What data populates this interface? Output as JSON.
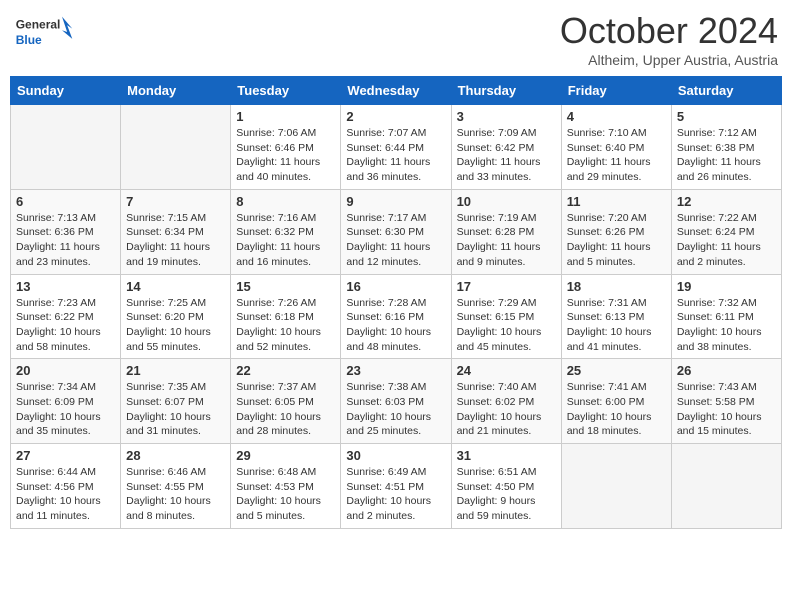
{
  "header": {
    "logo_general": "General",
    "logo_blue": "Blue",
    "month_title": "October 2024",
    "location": "Altheim, Upper Austria, Austria"
  },
  "days_of_week": [
    "Sunday",
    "Monday",
    "Tuesday",
    "Wednesday",
    "Thursday",
    "Friday",
    "Saturday"
  ],
  "weeks": [
    [
      {
        "day": "",
        "sunrise": "",
        "sunset": "",
        "daylight": ""
      },
      {
        "day": "",
        "sunrise": "",
        "sunset": "",
        "daylight": ""
      },
      {
        "day": "1",
        "sunrise": "Sunrise: 7:06 AM",
        "sunset": "Sunset: 6:46 PM",
        "daylight": "Daylight: 11 hours and 40 minutes."
      },
      {
        "day": "2",
        "sunrise": "Sunrise: 7:07 AM",
        "sunset": "Sunset: 6:44 PM",
        "daylight": "Daylight: 11 hours and 36 minutes."
      },
      {
        "day": "3",
        "sunrise": "Sunrise: 7:09 AM",
        "sunset": "Sunset: 6:42 PM",
        "daylight": "Daylight: 11 hours and 33 minutes."
      },
      {
        "day": "4",
        "sunrise": "Sunrise: 7:10 AM",
        "sunset": "Sunset: 6:40 PM",
        "daylight": "Daylight: 11 hours and 29 minutes."
      },
      {
        "day": "5",
        "sunrise": "Sunrise: 7:12 AM",
        "sunset": "Sunset: 6:38 PM",
        "daylight": "Daylight: 11 hours and 26 minutes."
      }
    ],
    [
      {
        "day": "6",
        "sunrise": "Sunrise: 7:13 AM",
        "sunset": "Sunset: 6:36 PM",
        "daylight": "Daylight: 11 hours and 23 minutes."
      },
      {
        "day": "7",
        "sunrise": "Sunrise: 7:15 AM",
        "sunset": "Sunset: 6:34 PM",
        "daylight": "Daylight: 11 hours and 19 minutes."
      },
      {
        "day": "8",
        "sunrise": "Sunrise: 7:16 AM",
        "sunset": "Sunset: 6:32 PM",
        "daylight": "Daylight: 11 hours and 16 minutes."
      },
      {
        "day": "9",
        "sunrise": "Sunrise: 7:17 AM",
        "sunset": "Sunset: 6:30 PM",
        "daylight": "Daylight: 11 hours and 12 minutes."
      },
      {
        "day": "10",
        "sunrise": "Sunrise: 7:19 AM",
        "sunset": "Sunset: 6:28 PM",
        "daylight": "Daylight: 11 hours and 9 minutes."
      },
      {
        "day": "11",
        "sunrise": "Sunrise: 7:20 AM",
        "sunset": "Sunset: 6:26 PM",
        "daylight": "Daylight: 11 hours and 5 minutes."
      },
      {
        "day": "12",
        "sunrise": "Sunrise: 7:22 AM",
        "sunset": "Sunset: 6:24 PM",
        "daylight": "Daylight: 11 hours and 2 minutes."
      }
    ],
    [
      {
        "day": "13",
        "sunrise": "Sunrise: 7:23 AM",
        "sunset": "Sunset: 6:22 PM",
        "daylight": "Daylight: 10 hours and 58 minutes."
      },
      {
        "day": "14",
        "sunrise": "Sunrise: 7:25 AM",
        "sunset": "Sunset: 6:20 PM",
        "daylight": "Daylight: 10 hours and 55 minutes."
      },
      {
        "day": "15",
        "sunrise": "Sunrise: 7:26 AM",
        "sunset": "Sunset: 6:18 PM",
        "daylight": "Daylight: 10 hours and 52 minutes."
      },
      {
        "day": "16",
        "sunrise": "Sunrise: 7:28 AM",
        "sunset": "Sunset: 6:16 PM",
        "daylight": "Daylight: 10 hours and 48 minutes."
      },
      {
        "day": "17",
        "sunrise": "Sunrise: 7:29 AM",
        "sunset": "Sunset: 6:15 PM",
        "daylight": "Daylight: 10 hours and 45 minutes."
      },
      {
        "day": "18",
        "sunrise": "Sunrise: 7:31 AM",
        "sunset": "Sunset: 6:13 PM",
        "daylight": "Daylight: 10 hours and 41 minutes."
      },
      {
        "day": "19",
        "sunrise": "Sunrise: 7:32 AM",
        "sunset": "Sunset: 6:11 PM",
        "daylight": "Daylight: 10 hours and 38 minutes."
      }
    ],
    [
      {
        "day": "20",
        "sunrise": "Sunrise: 7:34 AM",
        "sunset": "Sunset: 6:09 PM",
        "daylight": "Daylight: 10 hours and 35 minutes."
      },
      {
        "day": "21",
        "sunrise": "Sunrise: 7:35 AM",
        "sunset": "Sunset: 6:07 PM",
        "daylight": "Daylight: 10 hours and 31 minutes."
      },
      {
        "day": "22",
        "sunrise": "Sunrise: 7:37 AM",
        "sunset": "Sunset: 6:05 PM",
        "daylight": "Daylight: 10 hours and 28 minutes."
      },
      {
        "day": "23",
        "sunrise": "Sunrise: 7:38 AM",
        "sunset": "Sunset: 6:03 PM",
        "daylight": "Daylight: 10 hours and 25 minutes."
      },
      {
        "day": "24",
        "sunrise": "Sunrise: 7:40 AM",
        "sunset": "Sunset: 6:02 PM",
        "daylight": "Daylight: 10 hours and 21 minutes."
      },
      {
        "day": "25",
        "sunrise": "Sunrise: 7:41 AM",
        "sunset": "Sunset: 6:00 PM",
        "daylight": "Daylight: 10 hours and 18 minutes."
      },
      {
        "day": "26",
        "sunrise": "Sunrise: 7:43 AM",
        "sunset": "Sunset: 5:58 PM",
        "daylight": "Daylight: 10 hours and 15 minutes."
      }
    ],
    [
      {
        "day": "27",
        "sunrise": "Sunrise: 6:44 AM",
        "sunset": "Sunset: 4:56 PM",
        "daylight": "Daylight: 10 hours and 11 minutes."
      },
      {
        "day": "28",
        "sunrise": "Sunrise: 6:46 AM",
        "sunset": "Sunset: 4:55 PM",
        "daylight": "Daylight: 10 hours and 8 minutes."
      },
      {
        "day": "29",
        "sunrise": "Sunrise: 6:48 AM",
        "sunset": "Sunset: 4:53 PM",
        "daylight": "Daylight: 10 hours and 5 minutes."
      },
      {
        "day": "30",
        "sunrise": "Sunrise: 6:49 AM",
        "sunset": "Sunset: 4:51 PM",
        "daylight": "Daylight: 10 hours and 2 minutes."
      },
      {
        "day": "31",
        "sunrise": "Sunrise: 6:51 AM",
        "sunset": "Sunset: 4:50 PM",
        "daylight": "Daylight: 9 hours and 59 minutes."
      },
      {
        "day": "",
        "sunrise": "",
        "sunset": "",
        "daylight": ""
      },
      {
        "day": "",
        "sunrise": "",
        "sunset": "",
        "daylight": ""
      }
    ]
  ]
}
